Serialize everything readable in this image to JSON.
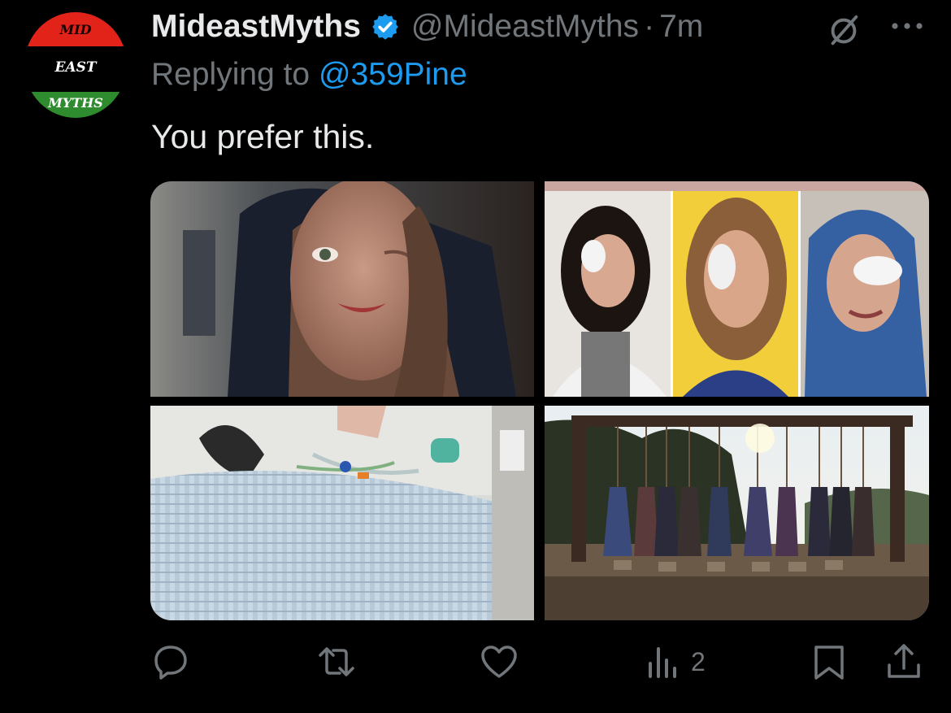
{
  "author": {
    "avatar_lines": [
      "MID",
      "EAST",
      "MYTHS"
    ],
    "display_name": "MideastMyths",
    "handle": "@MideastMyths",
    "separator": "·",
    "time": "7m",
    "verified": true
  },
  "reply": {
    "prefix": "Replying to",
    "mention": "@359Pine"
  },
  "tweet": {
    "text": "You prefer this."
  },
  "media": {
    "count": 4
  },
  "actions": {
    "views_count": "2"
  },
  "colors": {
    "background": "#000000",
    "primary_text": "#e7e9ea",
    "secondary_text": "#71767b",
    "link": "#1d9bf0",
    "verified_badge": "#1d9bf0"
  },
  "icons": [
    "verified-badge-icon",
    "grok-icon",
    "more-icon",
    "reply-icon",
    "retweet-icon",
    "like-icon",
    "views-icon",
    "bookmark-icon",
    "share-icon"
  ]
}
